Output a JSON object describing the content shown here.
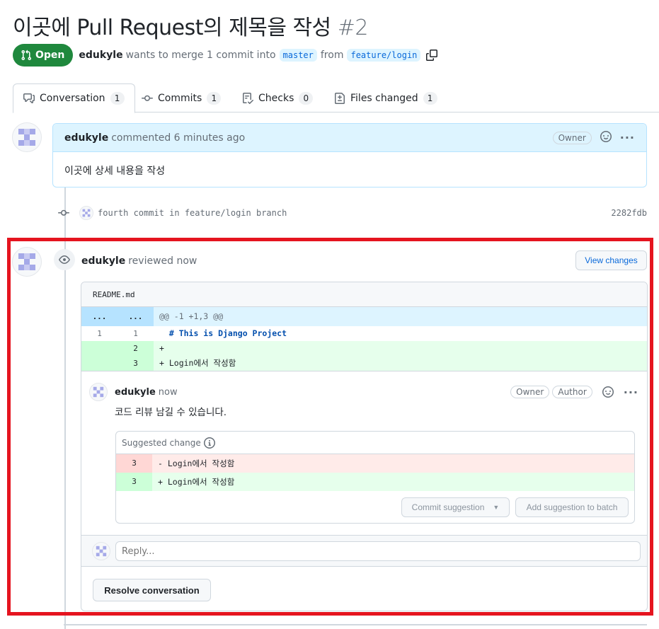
{
  "pr": {
    "title": "이곳에 Pull Request의 제목을 작성",
    "number": "#2",
    "state": "Open",
    "author": "edukyle",
    "merge_text": "wants to merge 1 commit into",
    "base_branch": "master",
    "from_text": "from",
    "head_branch": "feature/login"
  },
  "tabs": [
    {
      "label": "Conversation",
      "count": "1",
      "icon": "comment-discussion-icon"
    },
    {
      "label": "Commits",
      "count": "1",
      "icon": "git-commit-icon"
    },
    {
      "label": "Checks",
      "count": "0",
      "icon": "checklist-icon"
    },
    {
      "label": "Files changed",
      "count": "1",
      "icon": "file-diff-icon"
    }
  ],
  "main_comment": {
    "author": "edukyle",
    "action": "commented 6 minutes ago",
    "badge": "Owner",
    "body": "이곳에 상세 내용을 작성"
  },
  "commit": {
    "message": "fourth commit in feature/login branch",
    "sha": "2282fdb"
  },
  "review": {
    "author": "edukyle",
    "action": "reviewed now",
    "view_changes": "View changes",
    "file": "README.md",
    "hunk": {
      "left": "...",
      "right": "...",
      "text": "@@ -1 +1,3 @@"
    },
    "lines": [
      {
        "old": "1",
        "new": "1",
        "text": "  # This is Django Project"
      },
      {
        "old": "",
        "new": "2",
        "text": "+ "
      },
      {
        "old": "",
        "new": "3",
        "text": "+ Login에서 작성함"
      }
    ],
    "inline_comment": {
      "author": "edukyle",
      "time": "now",
      "badges": [
        "Owner",
        "Author"
      ],
      "body": "코드 리뷰 남길 수 있습니다.",
      "suggestion": {
        "header": "Suggested change",
        "deleted": {
          "line": "3",
          "text": "- Login에서 작성함"
        },
        "added": {
          "line": "3",
          "text": "+ Login에서 작성함"
        },
        "commit_button": "Commit suggestion",
        "batch_button": "Add suggestion to batch"
      }
    },
    "reply_placeholder": "Reply...",
    "resolve_button": "Resolve conversation"
  },
  "colors": {
    "open_green": "#1f883d",
    "link_blue": "#0969da",
    "highlight_red": "#e5141f",
    "comment_header_blue": "#ddf4ff"
  }
}
